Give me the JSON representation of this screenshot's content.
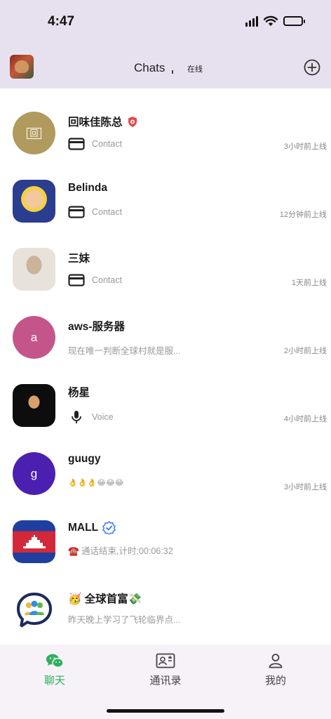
{
  "status_bar": {
    "time": "4:47"
  },
  "header": {
    "title": "Chats",
    "status": "在线"
  },
  "chats": [
    {
      "name": "回味佳陈总",
      "avatar_letter": "回",
      "avatar_color": "#b09a5e",
      "badge": "shield-icon",
      "subtitle": "Contact",
      "subtitle_icon": "card-icon",
      "time": "3小时前上线"
    },
    {
      "name": "Belinda",
      "avatar_letter": "",
      "avatar_color": "#2a3d8f",
      "subtitle": "Contact",
      "subtitle_icon": "card-icon",
      "time": "12分钟前上线"
    },
    {
      "name": "三妹",
      "avatar_letter": "",
      "avatar_color": "#d8d2c8",
      "subtitle": "Contact",
      "subtitle_icon": "card-icon",
      "time": "1天前上线"
    },
    {
      "name": "aws-服务器",
      "avatar_letter": "a",
      "avatar_color": "#c4558a",
      "subtitle": "现在唯一判断全球村就是服...",
      "time": "2小时前上线"
    },
    {
      "name": "杨星",
      "avatar_letter": "",
      "avatar_color": "#0d0d0d",
      "subtitle": "Voice",
      "subtitle_icon": "mic-icon",
      "time": "4小时前上线"
    },
    {
      "name": "guugy",
      "avatar_letter": "g",
      "avatar_color": "#4b1fb0",
      "subtitle": "👌👌👌😂😂😂",
      "time": "3小时前上线"
    },
    {
      "name": "MALL",
      "avatar_letter": "",
      "avatar_color": "#1f3fa0",
      "badge": "verified-icon",
      "subtitle": "☎️ 通话结束,计时:00:06:32",
      "time": ""
    },
    {
      "name": "🥳 全球首富💸",
      "avatar_letter": "",
      "avatar_color": "#ffffff",
      "subtitle": "昨天晚上学习了飞轮临界点...",
      "time": ""
    }
  ],
  "tabs": [
    {
      "label": "聊天",
      "icon": "wechat-icon",
      "active": true
    },
    {
      "label": "通讯录",
      "icon": "contacts-icon",
      "active": false
    },
    {
      "label": "我的",
      "icon": "profile-icon",
      "active": false
    }
  ],
  "colors": {
    "header_bg": "#e7e1ef",
    "tab_bg": "#f7f1f8",
    "active": "#2db05a",
    "muted": "#9a9a9a"
  }
}
